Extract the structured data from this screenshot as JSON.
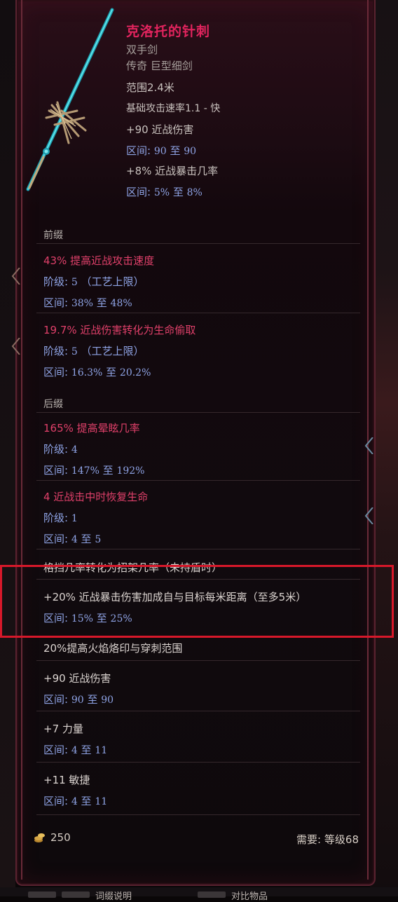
{
  "item": {
    "name": "克洛托的针刺",
    "type": "双手剑",
    "rarity_class": "传奇 巨型细剑",
    "range": "范围2.4米",
    "attack_rate": "基础攻击速率1.1 - 快",
    "implicits": [
      {
        "text": "+90 近战伤害",
        "range_label": "区间",
        "range_min": "90",
        "range_sep": "至",
        "range_max": "90"
      },
      {
        "text": "+8% 近战暴击几率",
        "range_label": "区间",
        "range_min": "5%",
        "range_sep": "至",
        "range_max": "8%"
      }
    ]
  },
  "prefix": {
    "header": "前缀",
    "affixes": [
      {
        "text": "43% 提高近战攻击速度",
        "tier_label": "阶级",
        "tier": "5",
        "tier_note": "（工艺上限）",
        "range_label": "区间",
        "range_min": "38%",
        "range_sep": "至",
        "range_max": "48%"
      },
      {
        "text": "19.7% 近战伤害转化为生命偷取",
        "tier_label": "阶级",
        "tier": "5",
        "tier_note": "（工艺上限）",
        "range_label": "区间",
        "range_min": "16.3%",
        "range_sep": "至",
        "range_max": "20.2%"
      }
    ]
  },
  "suffix": {
    "header": "后缀",
    "affixes": [
      {
        "text": "165% 提高晕眩几率",
        "tier_label": "阶级",
        "tier": "4",
        "range_label": "区间",
        "range_min": "147%",
        "range_sep": "至",
        "range_max": "192%"
      },
      {
        "text": "4 近战击中时恢复生命",
        "tier_label": "阶级",
        "tier": "1",
        "range_label": "区间",
        "range_min": "4",
        "range_sep": "至",
        "range_max": "5"
      }
    ]
  },
  "uniques": [
    {
      "text": "格挡几率转化为招架几率（未持盾时）"
    },
    {
      "text": "+20% 近战暴击伤害加成自与目标每米距离（至多5米）",
      "range_label": "区间",
      "range_min": "15%",
      "range_sep": "至",
      "range_max": "25%"
    },
    {
      "text": "20%提高火焰烙印与穿刺范围"
    },
    {
      "text": "+90 近战伤害",
      "range_label": "区间",
      "range_min": "90",
      "range_sep": "至",
      "range_max": "90"
    },
    {
      "text": "+7 力量",
      "range_label": "区间",
      "range_min": "4",
      "range_sep": "至",
      "range_max": "11"
    },
    {
      "text": "+11 敏捷",
      "range_label": "区间",
      "range_min": "4",
      "range_sep": "至",
      "range_max": "11"
    }
  ],
  "footer": {
    "gold": "250",
    "req_label": "需要:",
    "req_value": "等级",
    "req_level": "68"
  },
  "bottom": {
    "hint1": "词缀说明",
    "hint2": "对比物品"
  },
  "colors": {
    "name": "#e2245e",
    "affix_red": "#e0406a",
    "range_blue": "#8fa4e6",
    "highlight": "#d7182a"
  }
}
